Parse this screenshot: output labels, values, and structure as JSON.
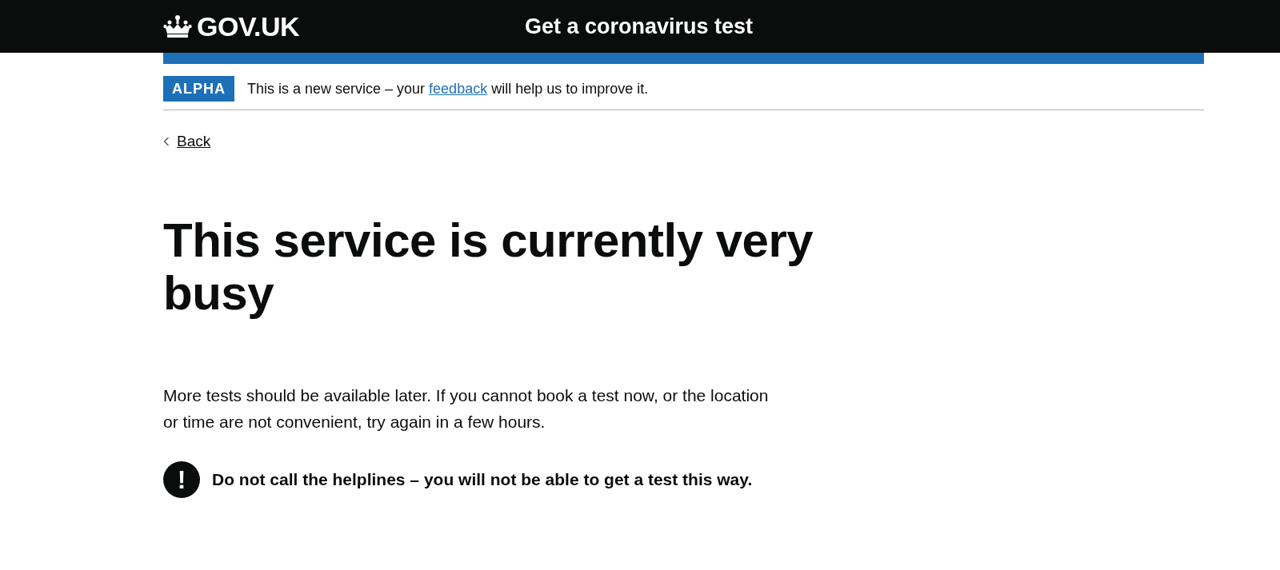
{
  "header": {
    "logo": "GOV.UK",
    "service_name": "Get a coronavirus test"
  },
  "phase_banner": {
    "tag": "ALPHA",
    "text_before": "This is a new service – your ",
    "link": "feedback",
    "text_after": " will help us to improve it."
  },
  "back_link": "Back",
  "heading": "This service is currently very busy",
  "body": "More tests should be available later. If you cannot book a test now, or the location or time are not convenient, try again in a few hours.",
  "warning": {
    "icon": "!",
    "text": "Do not call the helplines – you will not be able to get a test this way."
  }
}
